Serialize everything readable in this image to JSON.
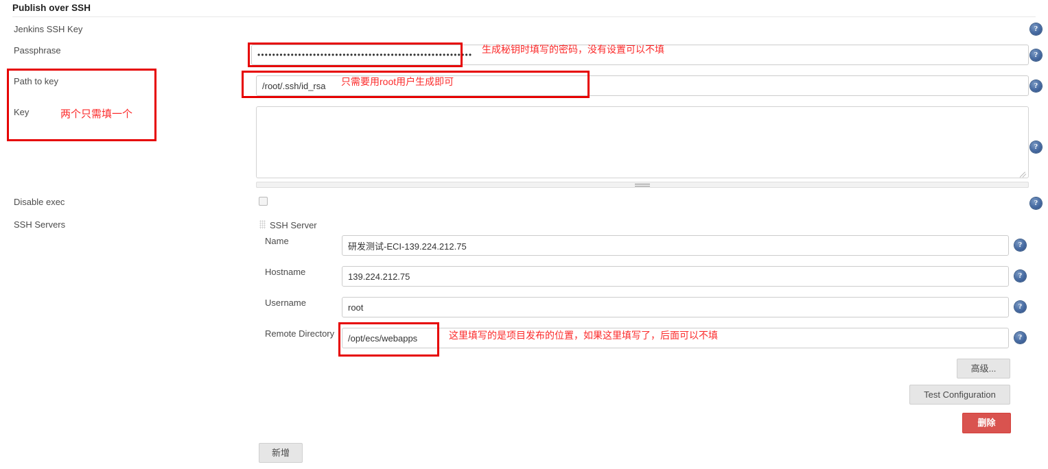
{
  "section": {
    "title": "Publish over SSH"
  },
  "rows": {
    "jenkins_ssh_key": {
      "label": "Jenkins SSH Key"
    },
    "passphrase": {
      "label": "Passphrase",
      "value": "••••••••••••••••••••••••••••••••••••••••••••••••••••••••••",
      "note": "生成秘钥时填写的密码，没有设置可以不填"
    },
    "path_to_key": {
      "label": "Path to key",
      "value": "/root/.ssh/id_rsa",
      "note": "只需要用root用户生成即可"
    },
    "key": {
      "label": "Key",
      "value": "",
      "note": "两个只需填一个"
    },
    "disable_exec": {
      "label": "Disable exec",
      "checked": false
    },
    "ssh_servers": {
      "label": "SSH Servers"
    }
  },
  "ssh_server": {
    "block_title": "SSH Server",
    "fields": {
      "name": {
        "label": "Name",
        "value": "研发测试-ECI-139.224.212.75"
      },
      "hostname": {
        "label": "Hostname",
        "value": "139.224.212.75"
      },
      "username": {
        "label": "Username",
        "value": "root"
      },
      "remote_directory": {
        "label": "Remote Directory",
        "value": "/opt/ecs/webapps",
        "note": "这里填写的是项目发布的位置，如果这里填写了，后面可以不填"
      }
    },
    "buttons": {
      "advanced": "高级...",
      "test_configuration": "Test Configuration",
      "delete": "删除"
    }
  },
  "footer": {
    "add_button": "新增"
  },
  "icons": {
    "help": "?"
  },
  "colors": {
    "annotation_red": "#fb2a2a",
    "box_red": "#e60000",
    "help_blue": "#3f63a0",
    "danger": "#d9534f"
  }
}
